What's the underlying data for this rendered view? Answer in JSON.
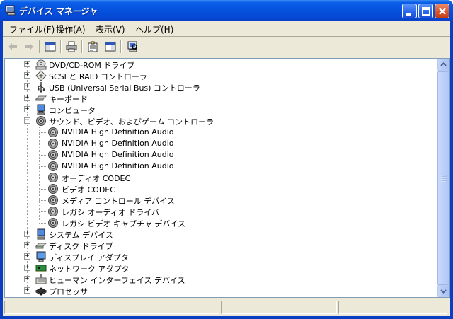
{
  "window": {
    "title": "デバイス マネージャ"
  },
  "menu": {
    "items": [
      {
        "label": "ファイル(F)"
      },
      {
        "label": "操作(A)"
      },
      {
        "label": "表示(V)"
      },
      {
        "label": "ヘルプ(H)"
      }
    ]
  },
  "toolbar": {
    "buttons": [
      "back-icon",
      "forward-icon",
      "show-hide-tree-icon",
      "print-icon",
      "properties-icon",
      "help-pane-icon",
      "scan-hardware-icon"
    ]
  },
  "tree": {
    "categories_top": [
      {
        "label": "DVD/CD-ROM ドライブ",
        "icon": "cd-drive-icon",
        "expanded": false
      },
      {
        "label": "SCSI と RAID コントローラ",
        "icon": "scsi-controller-icon",
        "expanded": false
      },
      {
        "label": "USB (Universal Serial Bus) コントローラ",
        "icon": "usb-icon",
        "expanded": false
      },
      {
        "label": "キーボード",
        "icon": "keyboard-icon",
        "expanded": false
      },
      {
        "label": "コンピュータ",
        "icon": "computer-icon",
        "expanded": false
      },
      {
        "label": "サウンド、ビデオ、およびゲーム コントローラ",
        "icon": "speaker-icon",
        "expanded": true
      }
    ],
    "sound_children": [
      {
        "label": "NVIDIA High Definition Audio"
      },
      {
        "label": "NVIDIA High Definition Audio"
      },
      {
        "label": "NVIDIA High Definition Audio"
      },
      {
        "label": "NVIDIA High Definition Audio"
      },
      {
        "label": "オーディオ CODEC"
      },
      {
        "label": "ビデオ CODEC"
      },
      {
        "label": "メディア コントロール デバイス"
      },
      {
        "label": "レガシ オーディオ ドライバ"
      },
      {
        "label": "レガシ ビデオ キャプチャ デバイス"
      }
    ],
    "categories_bottom": [
      {
        "label": "システム デバイス",
        "icon": "system-device-icon",
        "expanded": false
      },
      {
        "label": "ディスク ドライブ",
        "icon": "disk-drive-icon",
        "expanded": false
      },
      {
        "label": "ディスプレイ アダプタ",
        "icon": "display-adapter-icon",
        "expanded": false
      },
      {
        "label": "ネットワーク アダプタ",
        "icon": "network-adapter-icon",
        "expanded": false
      },
      {
        "label": "ヒューマン インターフェイス デバイス",
        "icon": "hid-icon",
        "expanded": false
      },
      {
        "label": "プロセッサ",
        "icon": "processor-icon",
        "expanded": false
      }
    ]
  },
  "colors": {
    "titlebar": "#0553de",
    "face": "#ece9d8",
    "tree_border": "#7f9db9"
  }
}
